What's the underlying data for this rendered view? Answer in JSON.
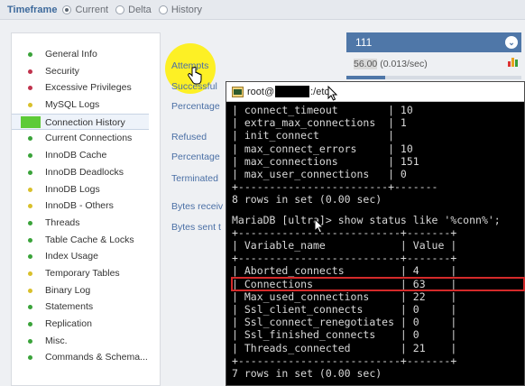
{
  "timeframe": {
    "label": "Timeframe",
    "options": [
      {
        "label": "Current",
        "selected": true
      },
      {
        "label": "Delta",
        "selected": false
      },
      {
        "label": "History",
        "selected": false
      }
    ]
  },
  "sidebar": {
    "items": [
      {
        "label": "General Info",
        "color": "#3aa33a"
      },
      {
        "label": "Security",
        "color": "#c0334d"
      },
      {
        "label": "Excessive Privileges",
        "color": "#c0334d"
      },
      {
        "label": "MySQL Logs",
        "color": "#d9c02b"
      },
      {
        "label": "Connection History",
        "color": "#5ecb37",
        "active": true
      },
      {
        "label": "Current Connections",
        "color": "#3aa33a"
      },
      {
        "label": "InnoDB Cache",
        "color": "#3aa33a"
      },
      {
        "label": "InnoDB Deadlocks",
        "color": "#3aa33a"
      },
      {
        "label": "InnoDB Logs",
        "color": "#d9c02b"
      },
      {
        "label": "InnoDB - Others",
        "color": "#d9c02b"
      },
      {
        "label": "Threads",
        "color": "#3aa33a"
      },
      {
        "label": "Table Cache & Locks",
        "color": "#3aa33a"
      },
      {
        "label": "Index Usage",
        "color": "#3aa33a"
      },
      {
        "label": "Temporary Tables",
        "color": "#d9c02b"
      },
      {
        "label": "Binary Log",
        "color": "#d9c02b"
      },
      {
        "label": "Statements",
        "color": "#3aa33a"
      },
      {
        "label": "Replication",
        "color": "#3aa33a"
      },
      {
        "label": "Misc.",
        "color": "#3aa33a"
      },
      {
        "label": "Commands & Schema...",
        "color": "#3aa33a"
      }
    ]
  },
  "middle": {
    "attempts": "Attempts",
    "successful": "Successful",
    "percentage1": "Percentage",
    "refused": "Refused",
    "percentage2": "Percentage",
    "terminated": "Terminated",
    "bytes_received": "Bytes receiv",
    "bytes_sent": "Bytes sent t"
  },
  "summary": {
    "value": "111",
    "rate_value": "56.00",
    "rate_rest": "(0.013/sec)",
    "progress_fraction": 0.22
  },
  "terminal": {
    "title_prefix": "root@",
    "title_suffix": ":/etc",
    "vars1": [
      {
        "name": "connect_timeout",
        "value": "10"
      },
      {
        "name": "extra_max_connections",
        "value": "1"
      },
      {
        "name": "init_connect",
        "value": ""
      },
      {
        "name": "max_connect_errors",
        "value": "10"
      },
      {
        "name": "max_connections",
        "value": "151"
      },
      {
        "name": "max_user_connections",
        "value": "0"
      }
    ],
    "result1": "8 rows in set (0.00 sec)",
    "prompt": "MariaDB [ultr",
    "prompt_end": "]> show status like '%conn%';",
    "header_name": "Variable_name",
    "header_value": "Value",
    "vars2": [
      {
        "name": "Aborted_connects",
        "value": "4"
      },
      {
        "name": "Connections",
        "value": "63",
        "highlight": true
      },
      {
        "name": "Max_used_connections",
        "value": "22"
      },
      {
        "name": "Ssl_client_connects",
        "value": "0"
      },
      {
        "name": "Ssl_connect_renegotiates",
        "value": "0"
      },
      {
        "name": "Ssl_finished_connects",
        "value": "0"
      },
      {
        "name": "Threads_connected",
        "value": "21"
      }
    ],
    "result2": "7 rows in set (0.00 sec)"
  }
}
